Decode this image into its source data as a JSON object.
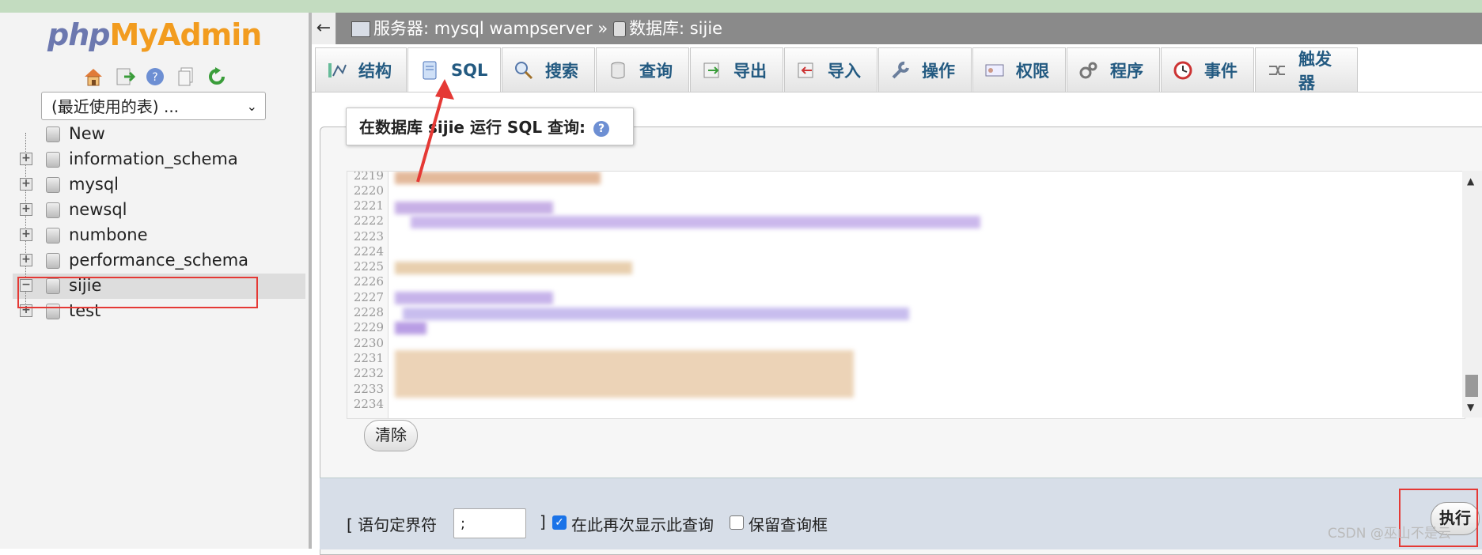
{
  "sidebar": {
    "logo": {
      "php": "php",
      "my": "MyAdmin"
    },
    "nav_icons": [
      "home-icon",
      "logout-icon",
      "help-icon",
      "docs-icon",
      "reload-icon"
    ],
    "recent_select": "(最近使用的表) ...",
    "tree": [
      {
        "label": "New"
      },
      {
        "label": "information_schema"
      },
      {
        "label": "mysql"
      },
      {
        "label": "newsql"
      },
      {
        "label": "numbone"
      },
      {
        "label": "performance_schema"
      },
      {
        "label": "sijie"
      },
      {
        "label": "test"
      }
    ]
  },
  "header": {
    "back": "←",
    "breadcrumb_server": "服务器: mysql wampserver",
    "breadcrumb_sep": "»",
    "breadcrumb_db": "数据库: sijie"
  },
  "tabs": [
    {
      "label": "结构",
      "icon": "structure-icon"
    },
    {
      "label": "SQL",
      "icon": "sql-icon",
      "active": true
    },
    {
      "label": "搜索",
      "icon": "search-icon"
    },
    {
      "label": "查询",
      "icon": "query-icon"
    },
    {
      "label": "导出",
      "icon": "export-icon"
    },
    {
      "label": "导入",
      "icon": "import-icon"
    },
    {
      "label": "操作",
      "icon": "wrench-icon"
    },
    {
      "label": "权限",
      "icon": "privileges-icon"
    },
    {
      "label": "程序",
      "icon": "routines-icon"
    },
    {
      "label": "事件",
      "icon": "events-icon"
    },
    {
      "label": "触发器",
      "icon": "triggers-icon"
    }
  ],
  "query_panel": {
    "legend": "在数据库 sijie 运行 SQL 查询:",
    "line_numbers": [
      "2219",
      "2220",
      "2221",
      "2222",
      "2223",
      "2224",
      "2225",
      "2226",
      "2227",
      "2228",
      "2229",
      "2230",
      "2231",
      "2232",
      "2233",
      "2234"
    ],
    "clear_button": "清除"
  },
  "footer": {
    "delimiter_label": "[ 语句定界符",
    "delimiter_value": ";",
    "delimiter_close": "]",
    "show_again_label": "在此再次显示此查询",
    "show_again_checked": true,
    "retain_box_label": "保留查询框",
    "retain_box_checked": false,
    "execute_button": "执行"
  },
  "watermark": "CSDN @巫山不是云",
  "colors": {
    "accent_red": "#e53935",
    "tab_text": "#235a81",
    "breadcrumb_bg": "#8a8a8a"
  }
}
